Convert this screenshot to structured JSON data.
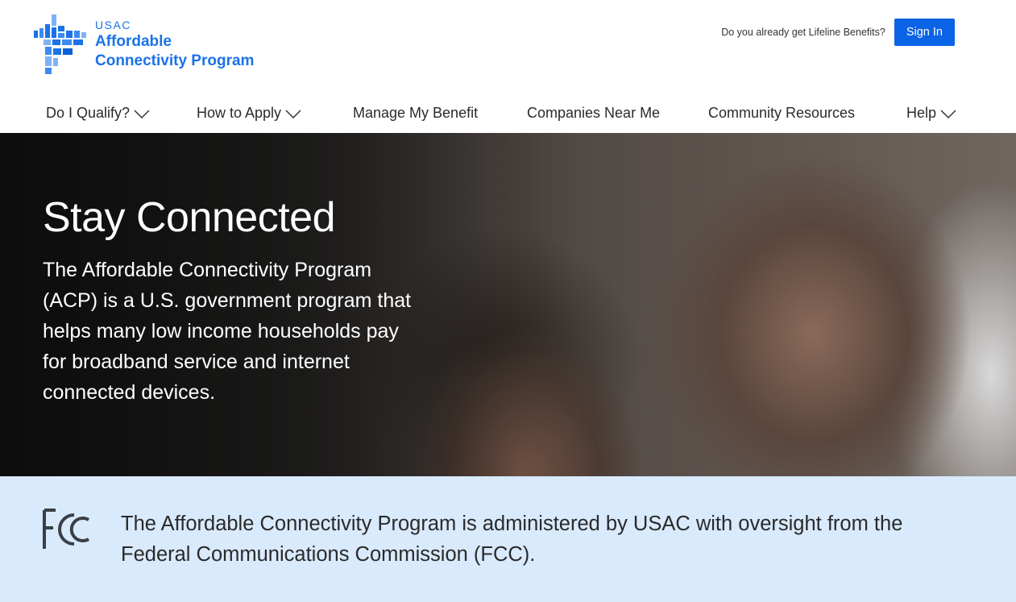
{
  "header": {
    "logo": {
      "usac": "USAC",
      "line1": "Affordable",
      "line2": "Connectivity Program",
      "icon": "acp-logo-mark",
      "color": "#1a73e8"
    },
    "signin_prompt": "Do you already get Lifeline Benefits?",
    "signin_label": "Sign In",
    "signin_color": "#0b63e5"
  },
  "nav": {
    "items": [
      {
        "label": "Do I Qualify?",
        "dropdown": true
      },
      {
        "label": "How to Apply",
        "dropdown": true
      },
      {
        "label": "Manage My Benefit",
        "dropdown": false
      },
      {
        "label": "Companies Near Me",
        "dropdown": false
      },
      {
        "label": "Community Resources",
        "dropdown": false
      },
      {
        "label": "Help",
        "dropdown": true
      }
    ]
  },
  "hero": {
    "title": "Stay Connected",
    "text": "The Affordable Connectivity Program (ACP) is a U.S. government program that helps many low income households pay for broadband service and internet connected devices."
  },
  "fcc": {
    "logo": "FCC",
    "text": "The Affordable Connectivity Program is administered by USAC with oversight from the Federal Communications Commission (FCC).",
    "band_color": "#d9eafc"
  }
}
